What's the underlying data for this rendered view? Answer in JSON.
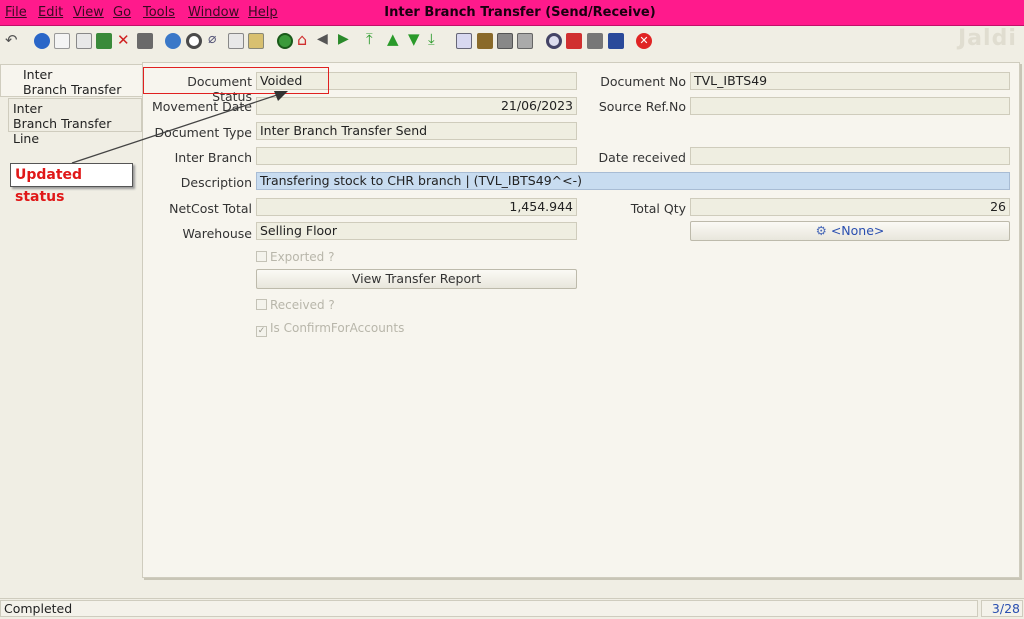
{
  "menu": {
    "items": [
      "File",
      "Edit",
      "View",
      "Go",
      "Tools",
      "Window",
      "Help"
    ],
    "title": "Inter Branch Transfer (Send/Receive)"
  },
  "logo_text": "Jaldi",
  "tabs": {
    "ibt_line1": "Inter",
    "ibt_line2": "Branch Transfer",
    "ibtl_line1": "Inter",
    "ibtl_line2": "Branch Transfer Line"
  },
  "form": {
    "document_status_label": "Document Status",
    "document_status": "Voided",
    "document_no_label": "Document No",
    "document_no": "TVL_IBTS49",
    "movement_date_label": "Movement Date",
    "movement_date": "21/06/2023",
    "source_ref_label": "Source Ref.No",
    "source_ref": "",
    "document_type_label": "Document Type",
    "document_type": "Inter Branch Transfer Send",
    "inter_branch_label": "Inter Branch",
    "inter_branch": "",
    "date_received_label": "Date received",
    "date_received": "",
    "description_label": "Description",
    "description": "Transfering stock to CHR branch | (TVL_IBTS49^<-)",
    "netcost_label": "NetCost Total",
    "netcost": "1,454.944",
    "total_qty_label": "Total Qty",
    "total_qty": "26",
    "warehouse_label": "Warehouse",
    "warehouse": "Selling Floor",
    "none_button": "<None>",
    "exported_label": "Exported ?",
    "view_report_button": "View Transfer Report",
    "received_label": "Received ?",
    "confirm_label": "Is ConfirmForAccounts"
  },
  "annotation": {
    "callout": "Updated status"
  },
  "status": {
    "text": "Completed",
    "record": "3/28"
  }
}
